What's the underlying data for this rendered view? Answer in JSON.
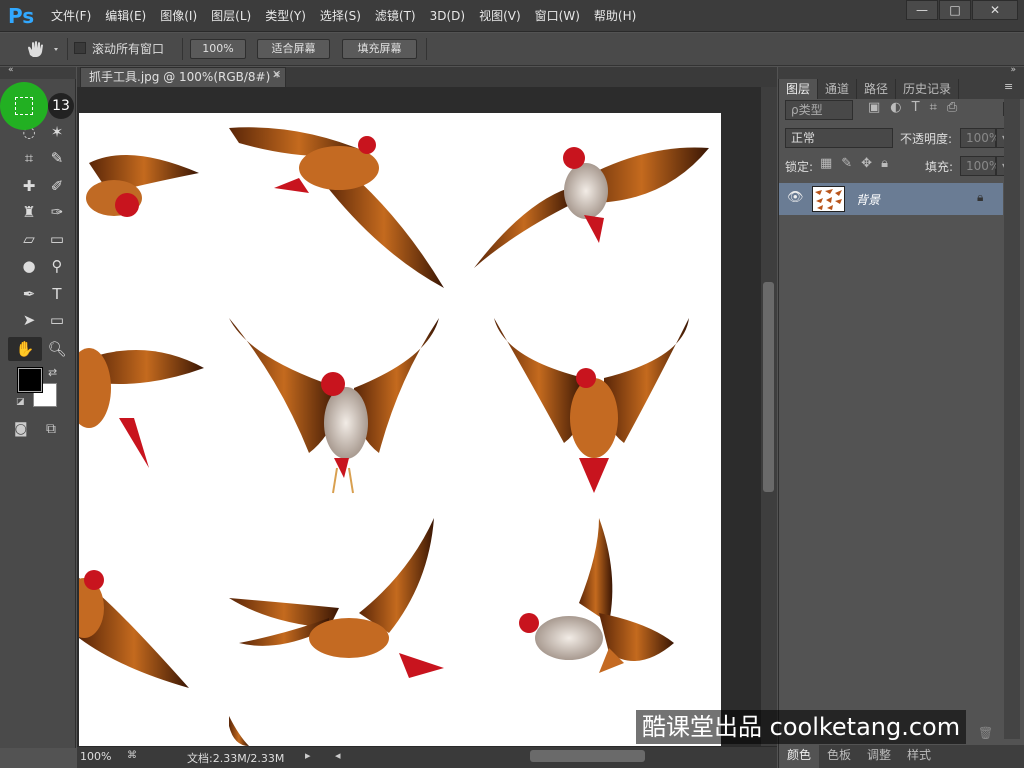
{
  "app": {
    "logo": "Ps"
  },
  "menubar": {
    "items": [
      "文件(F)",
      "编辑(E)",
      "图像(I)",
      "图层(L)",
      "类型(Y)",
      "选择(S)",
      "滤镜(T)",
      "3D(D)",
      "视图(V)",
      "窗口(W)",
      "帮助(H)"
    ],
    "minimize": "—",
    "maximize": "□",
    "close": "✕"
  },
  "options": {
    "scroll_all_label": "滚动所有窗口",
    "zoom_100": "100%",
    "fit_screen": "适合屏幕",
    "fill_screen": "填充屏幕"
  },
  "document": {
    "tab_title": "抓手工具.jpg @ 100%(RGB/8#) *",
    "zoom": "100%",
    "doc_size": "文档:2.33M/2.33M"
  },
  "panel": {
    "tabs": [
      "图层",
      "通道",
      "路径",
      "历史记录"
    ],
    "filter_label": "ρ类型",
    "blend_mode": "正常",
    "opacity_label": "不透明度:",
    "opacity_value": "100%",
    "lock_label": "锁定:",
    "fill_label": "填充:",
    "fill_value": "100%",
    "layer_name": "背景",
    "bottom_tabs": [
      "颜色",
      "色板",
      "调整",
      "样式"
    ]
  },
  "overlay": {
    "step_number": "13",
    "watermark": "酷课堂出品 coolketang.com"
  },
  "colors": {
    "foreground": "#000000",
    "background": "#ffffff",
    "highlight": "#22b022"
  }
}
